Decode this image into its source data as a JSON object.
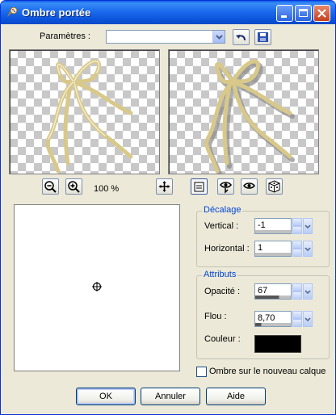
{
  "window": {
    "title": "Ombre portée"
  },
  "presets": {
    "label": "Paramètres :",
    "value": ""
  },
  "zoom": {
    "level": "100 %"
  },
  "offset": {
    "group_title": "Décalage",
    "vertical_label": "Vertical :",
    "vertical_value": "-1",
    "horizontal_label": "Horizontal :",
    "horizontal_value": "1"
  },
  "attributes": {
    "group_title": "Attributs",
    "opacity_label": "Opacité :",
    "opacity_value": "67",
    "blur_label": "Flou :",
    "blur_value": "8,70",
    "color_label": "Couleur :",
    "color_value": "#000000"
  },
  "new_layer_shadow": {
    "label": "Ombre sur le nouveau calque",
    "checked": false
  },
  "buttons": {
    "ok": "OK",
    "cancel": "Annuler",
    "help": "Aide"
  },
  "colors": {
    "title_bar": "#0a5ce8",
    "dialog_bg": "#ece9d8",
    "group_title": "#0046d5",
    "ribbon_gold": "#d8c98a"
  },
  "icons": [
    "paint-palette-icon",
    "minimize-icon",
    "maximize-icon",
    "close-icon",
    "chevron-down-icon",
    "undo-icon",
    "save-icon",
    "zoom-out-icon",
    "zoom-in-icon",
    "move-icon",
    "proof-icon",
    "auto-proof-icon",
    "reset-icon",
    "randomize-icon",
    "crosshair-icon"
  ]
}
